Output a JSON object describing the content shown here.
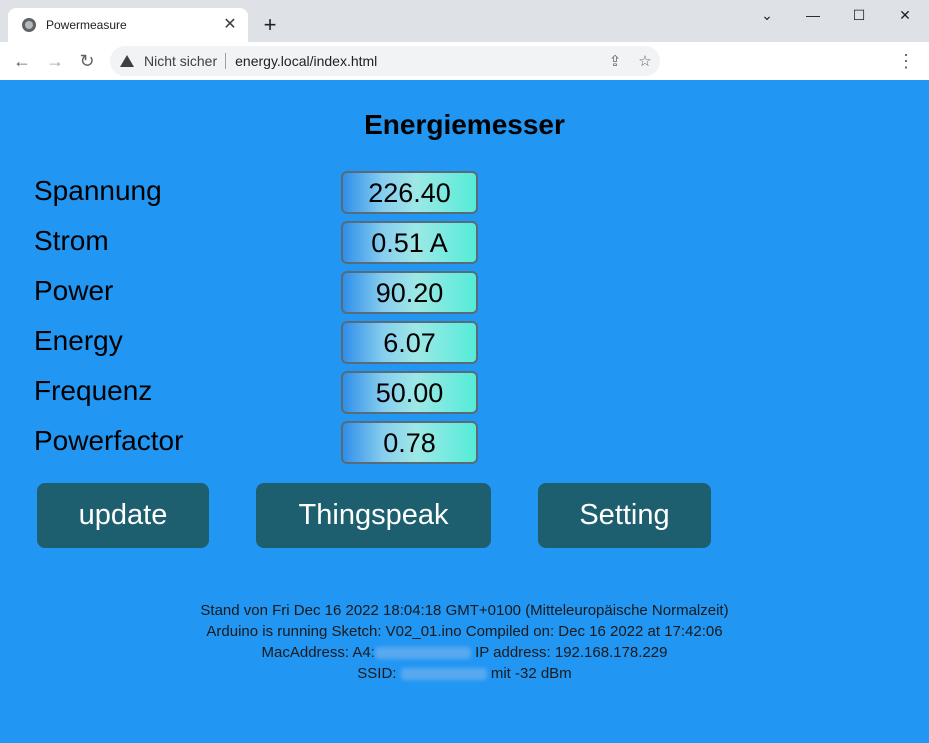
{
  "browser": {
    "tab_title": "Powermeasure",
    "new_tab": "+",
    "security_text": "Nicht sicher",
    "url": "energy.local/index.html",
    "window_controls": {
      "minimize": "—",
      "maximize": "☐",
      "close": "✕",
      "expand": "⌄"
    }
  },
  "page": {
    "title": "Energiemesser",
    "background_color": "#2196f3",
    "readings": [
      {
        "label": "Spannung",
        "value": "226.40"
      },
      {
        "label": "Strom",
        "value": "0.51 A"
      },
      {
        "label": "Power",
        "value": "90.20"
      },
      {
        "label": "Energy",
        "value": "6.07"
      },
      {
        "label": "Frequenz",
        "value": "50.00"
      },
      {
        "label": "Powerfactor",
        "value": "0.78"
      }
    ],
    "buttons": {
      "update": "update",
      "thingspeak": "Thingspeak",
      "setting": "Setting",
      "color": "#1d5f6e"
    },
    "footer": {
      "line1": "Stand von Fri Dec 16 2022 18:04:18 GMT+0100 (Mitteleuropäische Normalzeit)",
      "line2": "Arduino is running Sketch: V02_01.ino Compiled on: Dec 16 2022 at 17:42:06",
      "mac_prefix": "MacAddress: A4:",
      "ip": "IP address: 192.168.178.229",
      "ssid_prefix": "SSID:",
      "ssid_suffix": "mit -32 dBm"
    }
  }
}
